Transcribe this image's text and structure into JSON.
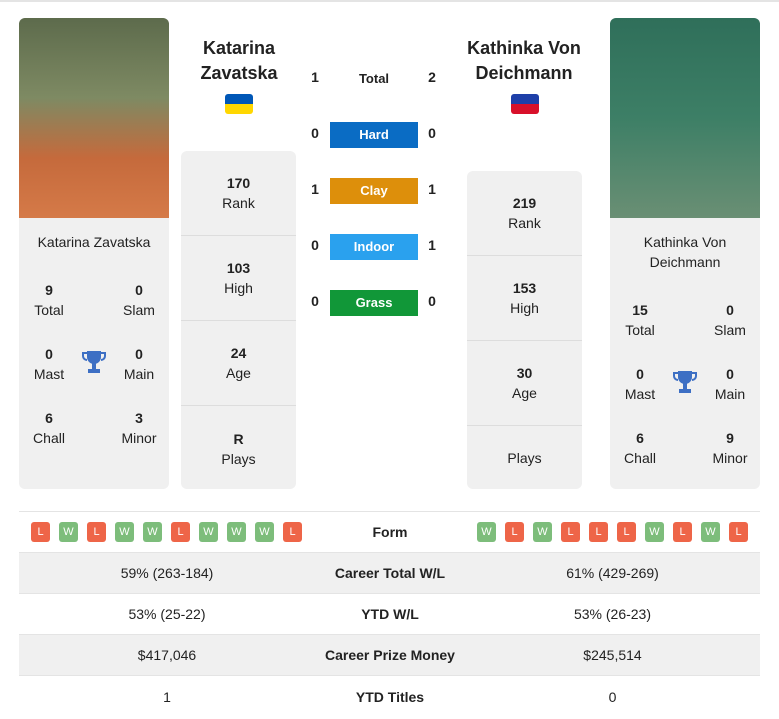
{
  "player1": {
    "name": "Katarina Zavatska",
    "header_name": "Katarina Zavatska",
    "flag_colors": [
      "#0057b7",
      "#ffd700"
    ],
    "card": {
      "total": "9",
      "total_label": "Total",
      "slam": "0",
      "slam_label": "Slam",
      "mast": "0",
      "mast_label": "Mast",
      "main": "0",
      "main_label": "Main",
      "chall": "6",
      "chall_label": "Chall",
      "minor": "3",
      "minor_label": "Minor"
    },
    "stats": [
      {
        "value": "170",
        "label": "Rank"
      },
      {
        "value": "103",
        "label": "High"
      },
      {
        "value": "24",
        "label": "Age"
      },
      {
        "value": "R",
        "label": "Plays"
      }
    ],
    "form": [
      "L",
      "W",
      "L",
      "W",
      "W",
      "L",
      "W",
      "W",
      "W",
      "L"
    ],
    "career_wl": "59% (263-184)",
    "ytd_wl": "53% (25-22)",
    "prize": "$417,046",
    "ytd_titles": "1"
  },
  "player2": {
    "name": "Kathinka Von Deichmann",
    "header_name": "Kathinka Von Deichmann",
    "flag_colors": [
      "#1e3fa8",
      "#d8102a"
    ],
    "card": {
      "total": "15",
      "total_label": "Total",
      "slam": "0",
      "slam_label": "Slam",
      "mast": "0",
      "mast_label": "Mast",
      "main": "0",
      "main_label": "Main",
      "chall": "6",
      "chall_label": "Chall",
      "minor": "9",
      "minor_label": "Minor"
    },
    "stats": [
      {
        "value": "219",
        "label": "Rank"
      },
      {
        "value": "153",
        "label": "High"
      },
      {
        "value": "30",
        "label": "Age"
      },
      {
        "value": "",
        "label": "Plays"
      }
    ],
    "form": [
      "W",
      "L",
      "W",
      "L",
      "L",
      "L",
      "W",
      "L",
      "W",
      "L"
    ],
    "career_wl": "61% (429-269)",
    "ytd_wl": "53% (26-23)",
    "prize": "$245,514",
    "ytd_titles": "0"
  },
  "h2h": [
    {
      "label": "Total",
      "p1": "1",
      "p2": "2",
      "color": ""
    },
    {
      "label": "Hard",
      "p1": "0",
      "p2": "0",
      "color": "#0a6cc4"
    },
    {
      "label": "Clay",
      "p1": "1",
      "p2": "1",
      "color": "#dd8f0b"
    },
    {
      "label": "Indoor",
      "p1": "0",
      "p2": "1",
      "color": "#2aa1ee"
    },
    {
      "label": "Grass",
      "p1": "0",
      "p2": "0",
      "color": "#119738"
    }
  ],
  "table": {
    "form_label": "Form",
    "career_wl_label": "Career Total W/L",
    "ytd_wl_label": "YTD W/L",
    "prize_label": "Career Prize Money",
    "ytd_titles_label": "YTD Titles"
  }
}
